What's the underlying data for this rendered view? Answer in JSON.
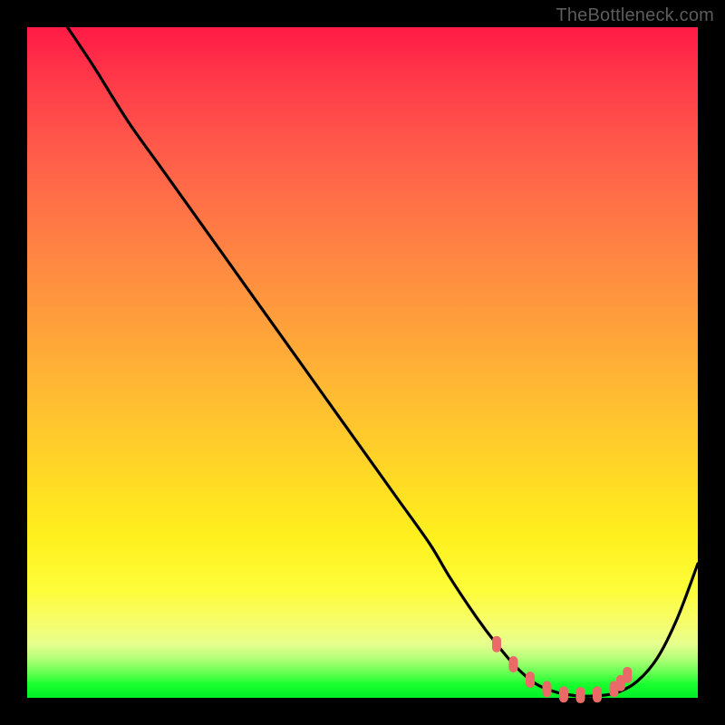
{
  "attribution": "TheBottleneck.com",
  "chart_data": {
    "type": "line",
    "title": "",
    "xlabel": "",
    "ylabel": "",
    "xlim": [
      0,
      100
    ],
    "ylim": [
      0,
      100
    ],
    "curve": {
      "name": "bottleneck-curve",
      "x": [
        6,
        10,
        15,
        20,
        25,
        30,
        35,
        40,
        45,
        50,
        55,
        60,
        63,
        67,
        70,
        73,
        76,
        79,
        82,
        85,
        88,
        91,
        94,
        97,
        100
      ],
      "y": [
        100,
        94,
        86,
        79,
        72,
        65,
        58,
        51,
        44,
        37,
        30,
        23,
        18,
        12,
        8,
        4.5,
        2,
        0.8,
        0.3,
        0.3,
        0.8,
        2.5,
        6,
        12,
        20
      ]
    },
    "markers": {
      "name": "optimal-zone",
      "color": "#e96a66",
      "x": [
        70,
        72.5,
        75,
        77.5,
        80,
        82.5,
        85,
        87.5,
        88.5,
        89.5
      ],
      "y": [
        8,
        5,
        2.7,
        1.3,
        0.5,
        0.4,
        0.5,
        1.3,
        2.2,
        3.4
      ]
    },
    "gradient_meaning": "vertical heat scale: red (high bottleneck) at top to green (optimal) at bottom"
  }
}
